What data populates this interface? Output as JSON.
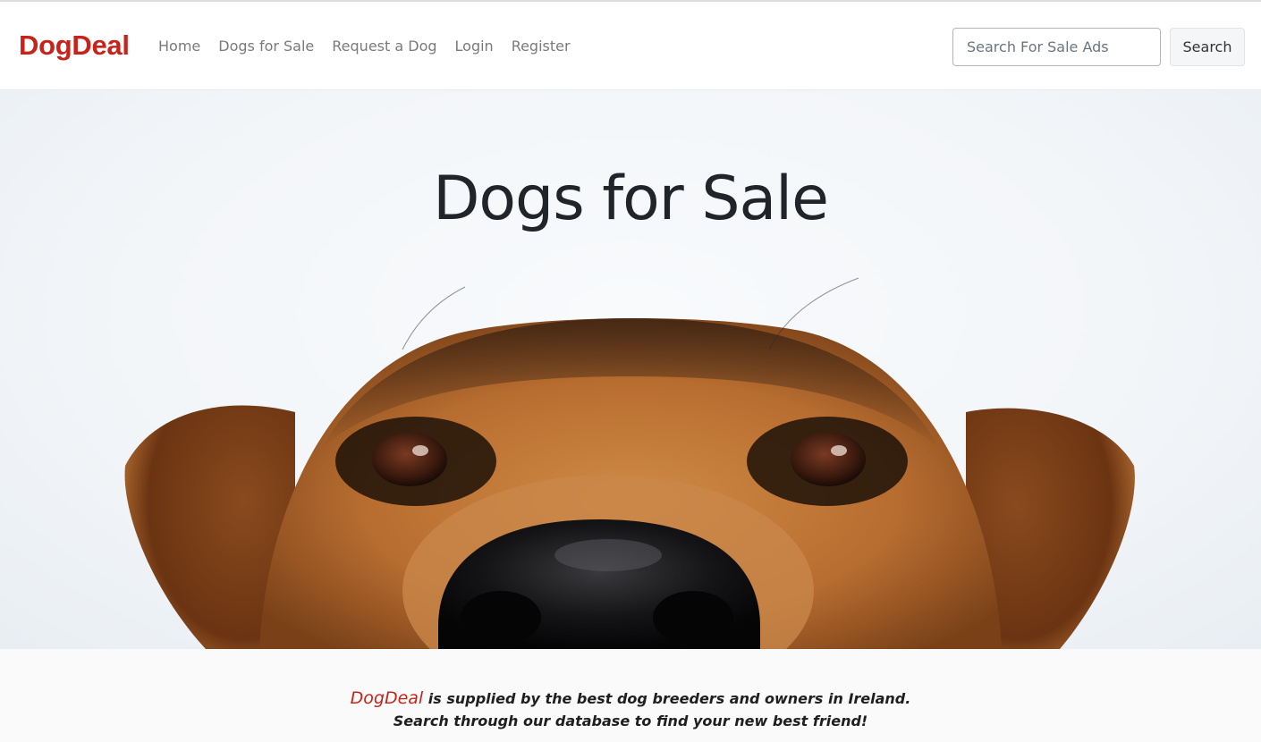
{
  "navbar": {
    "brand": "DogDeal",
    "links": [
      "Home",
      "Dogs for Sale",
      "Request a Dog",
      "Login",
      "Register"
    ],
    "search": {
      "placeholder": "Search For Sale Ads",
      "value": "",
      "button_label": "Search"
    }
  },
  "hero": {
    "title": "Dogs for Sale"
  },
  "tagline": {
    "brand": "DogDeal",
    "line1_rest": " is supplied by the best dog breeders and owners in Ireland.",
    "line2": "Search through our database to find your new best friend!"
  },
  "colors": {
    "brand": "#c8231b",
    "nav_link": "#7a7a7a",
    "text": "#212529"
  }
}
